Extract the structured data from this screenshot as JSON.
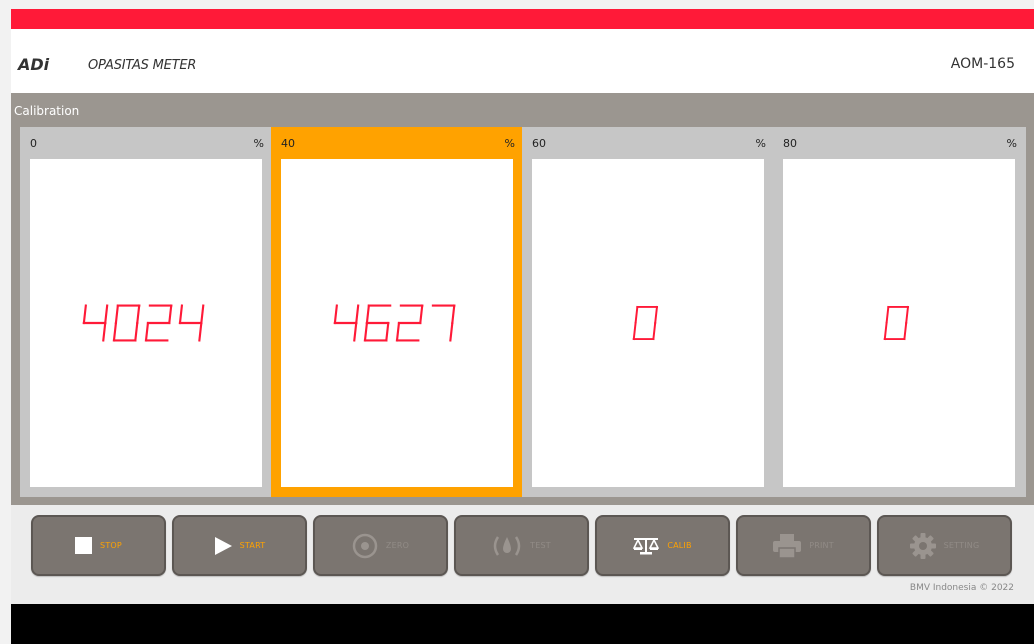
{
  "header": {
    "brand": "ADi",
    "subtitle": "OPASITAS METER",
    "model": "AOM-165"
  },
  "panel": {
    "title": "Calibration"
  },
  "cards": [
    {
      "label": "0",
      "unit": "%",
      "value": "4024",
      "active": false
    },
    {
      "label": "40",
      "unit": "%",
      "value": "4627",
      "active": true
    },
    {
      "label": "60",
      "unit": "%",
      "value": "0",
      "active": false
    },
    {
      "label": "80",
      "unit": "%",
      "value": "0",
      "active": false
    }
  ],
  "buttons": [
    {
      "label": "STOP",
      "icon": "stop-icon",
      "enabled": true
    },
    {
      "label": "START",
      "icon": "play-icon",
      "enabled": true
    },
    {
      "label": "ZERO",
      "icon": "target-icon",
      "enabled": false
    },
    {
      "label": "TEST",
      "icon": "gauge-icon",
      "enabled": false
    },
    {
      "label": "CALIB",
      "icon": "scale-icon",
      "enabled": true
    },
    {
      "label": "PRINT",
      "icon": "printer-icon",
      "enabled": false
    },
    {
      "label": "SETTING",
      "icon": "gear-icon",
      "enabled": false
    }
  ],
  "footer": {
    "copyright": "BMV Indonesia © 2022"
  },
  "colors": {
    "accent_red": "#ff1a38",
    "active_orange": "#ffa200",
    "display_red": "#ff1a38",
    "panel_gray": "#9b9690",
    "button_gray": "#7b7570"
  }
}
